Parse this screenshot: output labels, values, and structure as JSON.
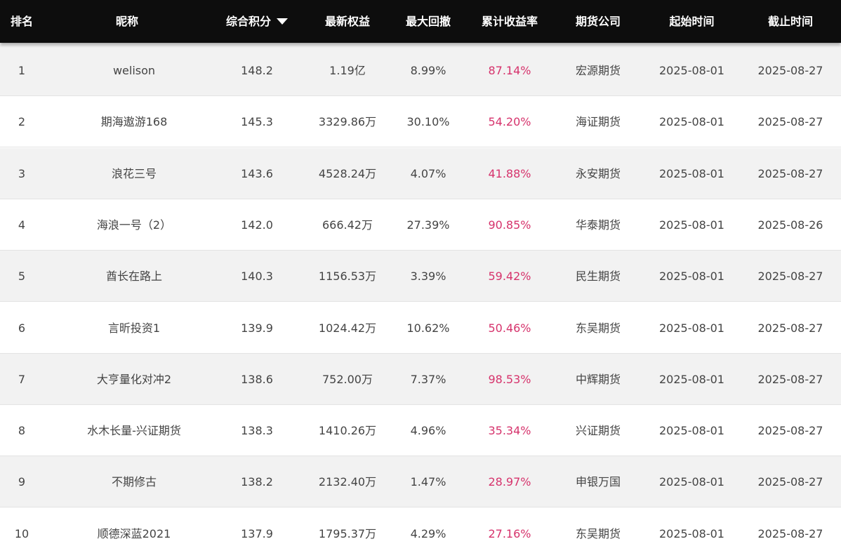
{
  "headers": {
    "rank": "排名",
    "nickname": "昵称",
    "score": "综合积分",
    "equity": "最新权益",
    "drawdown": "最大回撤",
    "return": "累计收益率",
    "company": "期货公司",
    "start": "起始时间",
    "end": "截止时间"
  },
  "colors": {
    "header_bg": "#0d0d0d",
    "return_text": "#d6336c",
    "row_alt_bg": "#f2f2f2"
  },
  "rows": [
    {
      "rank": "1",
      "nickname": "welison",
      "score": "148.2",
      "equity": "1.19亿",
      "drawdown": "8.99%",
      "return": "87.14%",
      "company": "宏源期货",
      "start": "2025-08-01",
      "end": "2025-08-27"
    },
    {
      "rank": "2",
      "nickname": "期海遨游168",
      "score": "145.3",
      "equity": "3329.86万",
      "drawdown": "30.10%",
      "return": "54.20%",
      "company": "海证期货",
      "start": "2025-08-01",
      "end": "2025-08-27"
    },
    {
      "rank": "3",
      "nickname": "浪花三号",
      "score": "143.6",
      "equity": "4528.24万",
      "drawdown": "4.07%",
      "return": "41.88%",
      "company": "永安期货",
      "start": "2025-08-01",
      "end": "2025-08-27"
    },
    {
      "rank": "4",
      "nickname": "海浪一号（2）",
      "score": "142.0",
      "equity": "666.42万",
      "drawdown": "27.39%",
      "return": "90.85%",
      "company": "华泰期货",
      "start": "2025-08-01",
      "end": "2025-08-26"
    },
    {
      "rank": "5",
      "nickname": "酋长在路上",
      "score": "140.3",
      "equity": "1156.53万",
      "drawdown": "3.39%",
      "return": "59.42%",
      "company": "民生期货",
      "start": "2025-08-01",
      "end": "2025-08-27"
    },
    {
      "rank": "6",
      "nickname": "言昕投资1",
      "score": "139.9",
      "equity": "1024.42万",
      "drawdown": "10.62%",
      "return": "50.46%",
      "company": "东吴期货",
      "start": "2025-08-01",
      "end": "2025-08-27"
    },
    {
      "rank": "7",
      "nickname": "大亨量化对冲2",
      "score": "138.6",
      "equity": "752.00万",
      "drawdown": "7.37%",
      "return": "98.53%",
      "company": "中辉期货",
      "start": "2025-08-01",
      "end": "2025-08-27"
    },
    {
      "rank": "8",
      "nickname": "水木长量-兴证期货",
      "score": "138.3",
      "equity": "1410.26万",
      "drawdown": "4.96%",
      "return": "35.34%",
      "company": "兴证期货",
      "start": "2025-08-01",
      "end": "2025-08-27"
    },
    {
      "rank": "9",
      "nickname": "不期修古",
      "score": "138.2",
      "equity": "2132.40万",
      "drawdown": "1.47%",
      "return": "28.97%",
      "company": "申银万国",
      "start": "2025-08-01",
      "end": "2025-08-27"
    },
    {
      "rank": "10",
      "nickname": "顺德深蓝2021",
      "score": "137.9",
      "equity": "1795.37万",
      "drawdown": "4.29%",
      "return": "27.16%",
      "company": "东吴期货",
      "start": "2025-08-01",
      "end": "2025-08-27"
    }
  ]
}
